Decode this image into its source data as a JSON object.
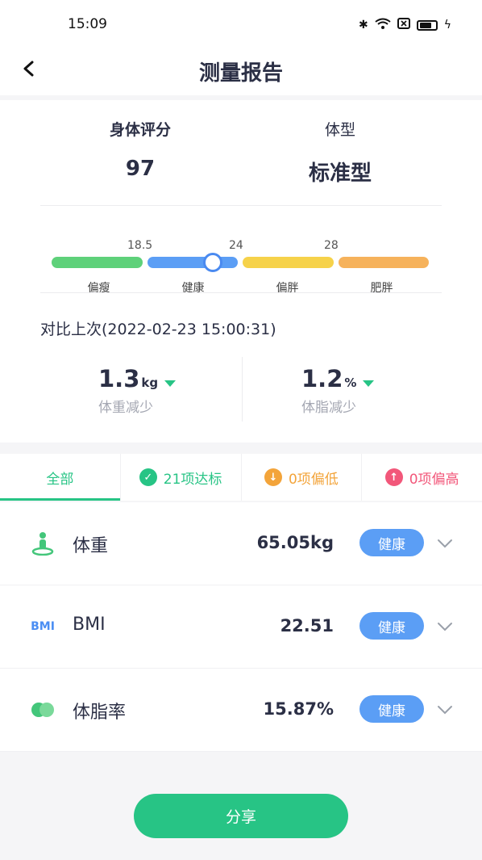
{
  "status": {
    "time": "15:09"
  },
  "nav": {
    "title": "测量报告"
  },
  "summary": {
    "score_label": "身体评分",
    "score_value": "97",
    "type_label": "体型",
    "type_value": "标准型"
  },
  "scale": {
    "ticks": [
      "18.5",
      "24",
      "28"
    ],
    "segments": [
      {
        "label": "偏瘦",
        "color": "#5ed17a"
      },
      {
        "label": "健康",
        "color": "#5b9ef5"
      },
      {
        "label": "偏胖",
        "color": "#f6d24a"
      },
      {
        "label": "肥胖",
        "color": "#f6b25b"
      }
    ],
    "current_bmi": 22.51
  },
  "compare": {
    "title": "对比上次(2022-02-23 15:00:31)",
    "weight": {
      "value": "1.3",
      "unit": "kg",
      "label": "体重减少"
    },
    "fat": {
      "value": "1.2",
      "unit": "%",
      "label": "体脂减少"
    }
  },
  "tabs": [
    {
      "label": "全部"
    },
    {
      "label": "21项达标",
      "color": "#27c485",
      "icon": "check-icon"
    },
    {
      "label": "0项偏低",
      "color": "#f3a43a",
      "icon": "arrow-down-icon"
    },
    {
      "label": "0项偏高",
      "color": "#f2577a",
      "icon": "arrow-up-icon"
    }
  ],
  "metrics": [
    {
      "name": "体重",
      "value": "65.05kg",
      "status": "健康",
      "icon": "weight-person-icon"
    },
    {
      "name": "BMI",
      "value": "22.51",
      "status": "健康",
      "icon": "bmi-icon",
      "icon_text": "BMI"
    },
    {
      "name": "体脂率",
      "value": "15.87%",
      "status": "健康",
      "icon": "body-fat-icon"
    }
  ],
  "share": {
    "label": "分享"
  },
  "colors": {
    "accent": "#27c485",
    "badge": "#5b9ef5"
  }
}
